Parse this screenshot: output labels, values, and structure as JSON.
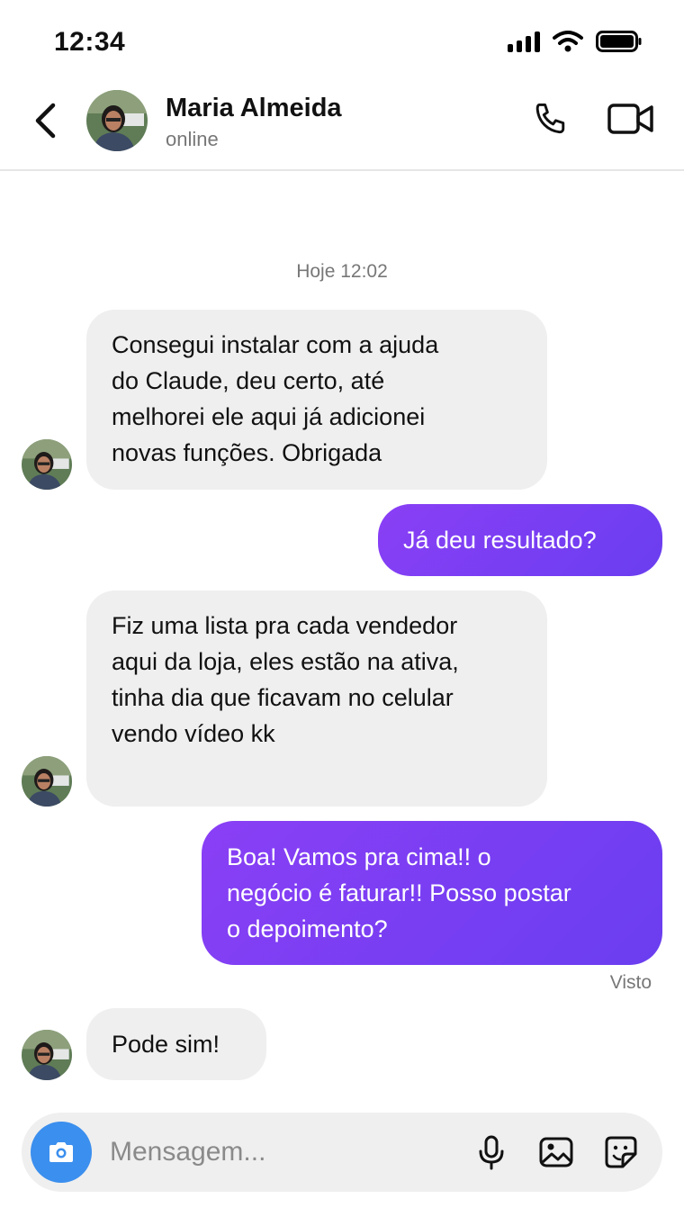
{
  "status_bar": {
    "time": "12:34"
  },
  "header": {
    "contact_name": "Maria Almeida",
    "contact_status": "online"
  },
  "chat": {
    "date_separator": "Hoje 12:02",
    "messages": [
      {
        "direction": "in",
        "lines": [
          "Consegui instalar com a ajuda",
          "do Claude, deu certo, até",
          "melhorei ele aqui já adicionei",
          "novas funções. Obrigada"
        ]
      },
      {
        "direction": "out",
        "lines": [
          "Já deu resultado?"
        ]
      },
      {
        "direction": "in",
        "lines": [
          "Fiz uma lista pra cada vendedor",
          "aqui da loja, eles estão na ativa,",
          "tinha dia que ficavam no celular",
          "vendo vídeo kk"
        ]
      },
      {
        "direction": "out",
        "lines": [
          "Boa! Vamos pra cima!! o",
          "negócio é faturar!! Posso postar",
          "o depoimento?"
        ]
      },
      {
        "direction": "in",
        "lines": [
          "Pode sim!"
        ]
      }
    ],
    "seen_label": "Visto"
  },
  "composer": {
    "placeholder": "Mensagem..."
  },
  "colors": {
    "accent": "#7b3ff2",
    "camera": "#3b8fee",
    "bubble_in": "#efefef"
  },
  "icons": [
    "back-icon",
    "phone-icon",
    "video-icon",
    "camera-icon",
    "microphone-icon",
    "image-icon",
    "sticker-icon",
    "signal-icon",
    "wifi-icon",
    "battery-icon"
  ]
}
